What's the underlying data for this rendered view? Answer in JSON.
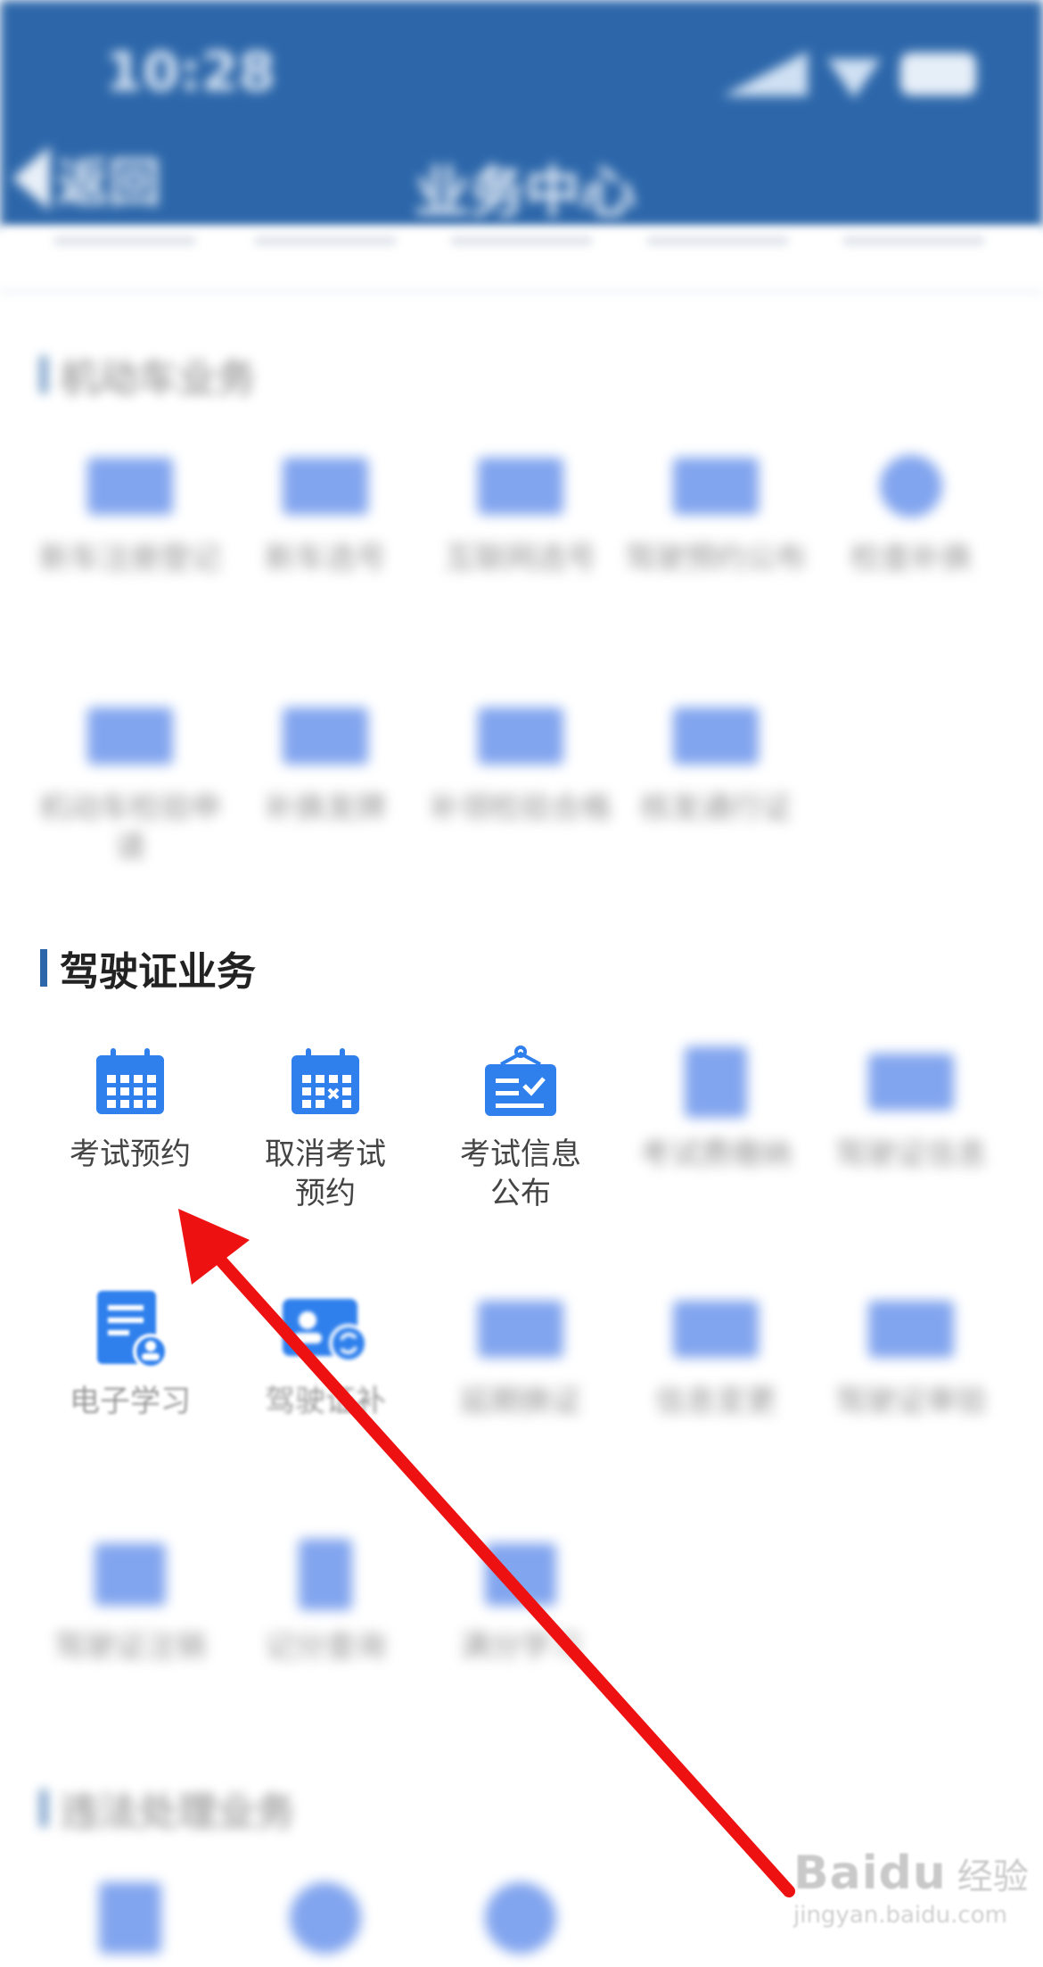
{
  "status": {
    "time": "10:28"
  },
  "nav": {
    "back_label": "返回",
    "title": "业务中心"
  },
  "sections": {
    "vehicle": {
      "title": "机动车业务",
      "items": [
        {
          "label": "新车注册登记"
        },
        {
          "label": "新车选号"
        },
        {
          "label": "互联网选号"
        },
        {
          "label": "驾驶预约公布"
        },
        {
          "label": "检查补换"
        },
        {
          "label": "机动车检验申请"
        },
        {
          "label": "补换发牌"
        },
        {
          "label": "补领检验合格"
        },
        {
          "label": "核发通行证"
        }
      ]
    },
    "driver": {
      "title": "驾驶证业务",
      "items": [
        {
          "label": "考试预约",
          "icon": "calendar-icon"
        },
        {
          "label": "取消考试预约",
          "icon": "calendar-cancel-icon"
        },
        {
          "label": "考试信息公布",
          "icon": "notice-board-icon"
        },
        {
          "label": "考试费缴纳",
          "icon": "id-card-icon"
        },
        {
          "label": "驾驶证信息",
          "icon": "id-card-icon"
        },
        {
          "label": "电子学习",
          "icon": "document-user-icon"
        },
        {
          "label": "驾驶证补",
          "icon": "card-renew-icon"
        },
        {
          "label": "延期换证",
          "icon": "id-card-icon"
        },
        {
          "label": "信息变更",
          "icon": "id-card-icon"
        },
        {
          "label": "驾驶证审验",
          "icon": "id-card-icon"
        },
        {
          "label": "驾驶证注销",
          "icon": "camera-icon"
        },
        {
          "label": "记分查询",
          "icon": "document-icon"
        },
        {
          "label": "满分学习",
          "icon": "camera-icon"
        }
      ]
    },
    "violation": {
      "title": "违法处理业务"
    }
  },
  "watermark": {
    "logo": "Baidu",
    "cn": "经验",
    "url": "jingyan.baidu.com"
  },
  "colors": {
    "header_bg": "#2d67aa",
    "icon_blue": "#2f80ed",
    "arrow": "#ee1111"
  }
}
